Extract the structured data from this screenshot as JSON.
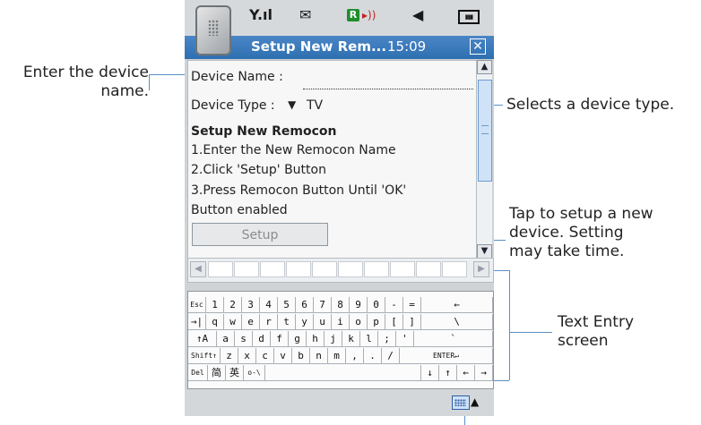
{
  "callouts": {
    "device_name_line1": "Enter the device",
    "device_name_line2": "name.",
    "device_type": "Selects a device type.",
    "setup_line1": "Tap to setup a new",
    "setup_line2": "device. Setting",
    "setup_line3": "may take time.",
    "text_entry_line1": "Text Entry",
    "text_entry_line2": "screen"
  },
  "status_icons": {
    "signal": "Y.ıl",
    "message": "✉",
    "r_badge": "R",
    "speaker": "◀",
    "battery": "▮▮▮"
  },
  "window": {
    "title": "Setup New Rem...",
    "time": "15:09",
    "close": "✕"
  },
  "form": {
    "device_name_label": "Device Name :",
    "device_type_label": "Device Type :",
    "device_type_arrow": "▼",
    "device_type_value": "TV",
    "heading": "Setup New Remocon",
    "step1": "1.Enter the New Remocon Name",
    "step2": "2.Click 'Setup' Button",
    "step3": "3.Press Remocon Button Until 'OK'",
    "step3b": "Button enabled",
    "setup_button": "Setup"
  },
  "keyboard": {
    "rows": [
      [
        "Esc",
        "1",
        "2",
        "3",
        "4",
        "5",
        "6",
        "7",
        "8",
        "9",
        "0",
        "-",
        "=",
        "←"
      ],
      [
        "→|",
        "q",
        "w",
        "e",
        "r",
        "t",
        "y",
        "u",
        "i",
        "o",
        "p",
        "[",
        "]",
        "\\"
      ],
      [
        "↑A",
        "a",
        "s",
        "d",
        "f",
        "g",
        "h",
        "j",
        "k",
        "l",
        ";",
        "'",
        "`"
      ],
      [
        "Shift↑",
        "z",
        "x",
        "c",
        "v",
        "b",
        "n",
        "m",
        ",",
        ".",
        "/",
        "ENTER↵"
      ],
      [
        "Del",
        "简",
        "英",
        "o-\\",
        "",
        "↓",
        "↑",
        "←",
        "→"
      ]
    ]
  }
}
